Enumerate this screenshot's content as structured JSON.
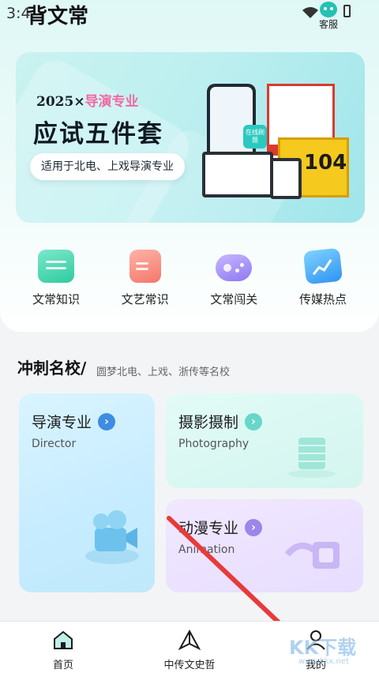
{
  "status_bar": {
    "time": "3:4",
    "service_label": "客服"
  },
  "app_title": "背文常",
  "banner": {
    "year": "2025×",
    "year_tag": "导演专业",
    "headline": "应试五件套",
    "pill": "适用于北电、上戏导演专业",
    "book_number": "104",
    "phone_chip": "在线刷题"
  },
  "categories": [
    {
      "label": "文常知识",
      "icon": "notes-icon"
    },
    {
      "label": "文艺常识",
      "icon": "document-icon"
    },
    {
      "label": "文常闯关",
      "icon": "gamepad-icon"
    },
    {
      "label": "传媒热点",
      "icon": "trend-icon"
    }
  ],
  "section": {
    "title": "冲刺名校/",
    "subtitle": "圆梦北电、上戏、浙传等名校"
  },
  "cards": {
    "director": {
      "title": "导演专业",
      "subtitle": "Director"
    },
    "photography": {
      "title": "摄影摄制",
      "subtitle": "Photography"
    },
    "animation": {
      "title": "动漫专业",
      "subtitle": "Animation"
    }
  },
  "tabbar": [
    {
      "label": "首页",
      "icon": "home-icon"
    },
    {
      "label": "中传文史哲",
      "icon": "compass-icon"
    },
    {
      "label": "我的",
      "icon": "person-icon"
    }
  ],
  "watermark": {
    "text": "KK下载",
    "url": "www.kkx.net"
  },
  "colors": {
    "accent_teal": "#27c1b3",
    "arrow_red": "#e83a3a"
  }
}
